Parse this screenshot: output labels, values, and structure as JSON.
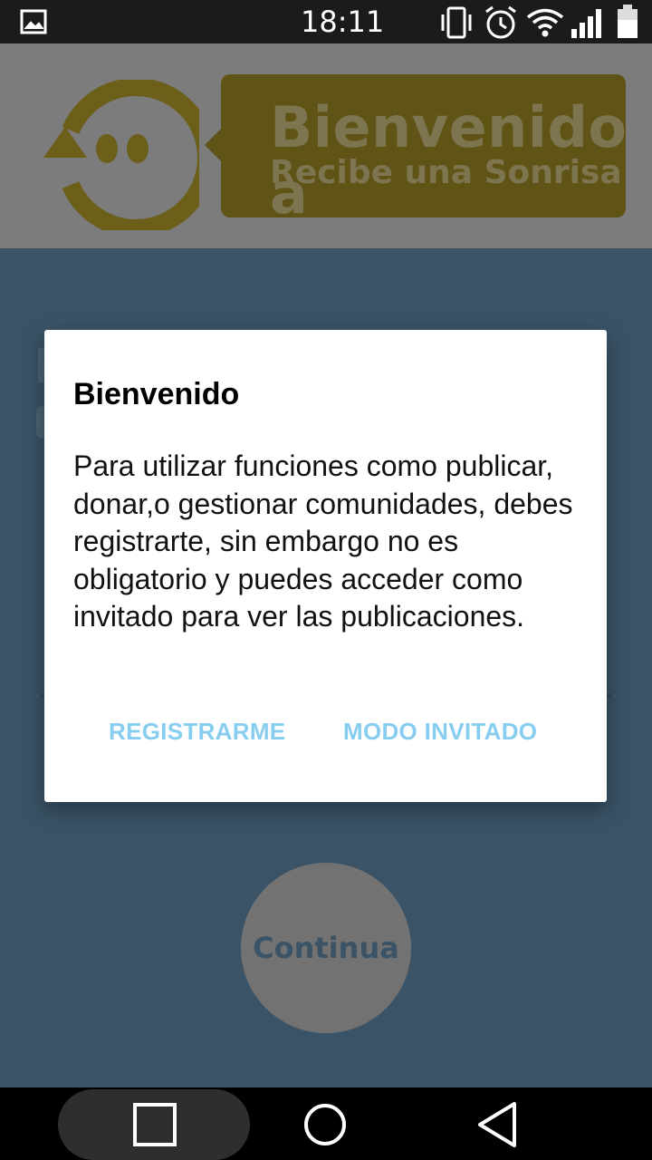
{
  "status_bar": {
    "time": "18:11",
    "icons": [
      "image-icon",
      "vibrate-icon",
      "alarm-icon",
      "wifi-icon",
      "signal-icon",
      "battery-icon"
    ]
  },
  "header": {
    "banner_line1": "Bienvenido a",
    "banner_line2": "Recibe una Sonrisa"
  },
  "dialog": {
    "title": "Bienvenido",
    "message": "Para utilizar funciones como publicar, donar,o gestionar comunidades, debes registrarte, sin embargo no es obligatorio y puedes acceder como invitado para ver las publicaciones.",
    "buttons": {
      "register": "REGISTRARME",
      "guest": "MODO INVITADO"
    }
  },
  "main": {
    "continue_label": "Continua"
  },
  "colors": {
    "accent_button_text": "#87cdf0",
    "background": "#3a5366",
    "header_dim": "#7c7c7c",
    "logo_yellow": "#6b5f1a"
  },
  "navigation_bar": {
    "buttons": [
      "recents-icon",
      "home-icon",
      "back-icon"
    ]
  }
}
